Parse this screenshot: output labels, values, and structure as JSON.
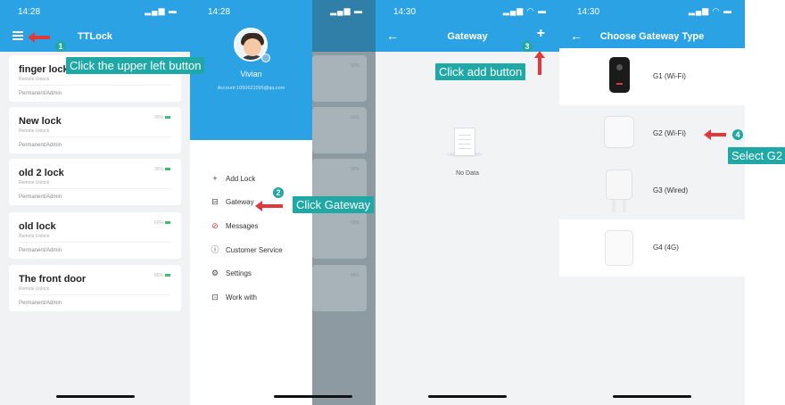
{
  "screens": {
    "locks": {
      "status_time": "14:28",
      "title": "TTLock",
      "locks": [
        {
          "name": "finger lock",
          "remote": "Remote Unlock",
          "permission": "Permanent/Admin",
          "battery": "",
          "battery_level": 0
        },
        {
          "name": "New lock",
          "remote": "Remote Unlock",
          "permission": "Permanent/Admin",
          "battery": "95%",
          "battery_level": 0.95
        },
        {
          "name": "old 2 lock",
          "remote": "Remote Unlock",
          "permission": "Permanent/Admin",
          "battery": "35%",
          "battery_level": 0.35
        },
        {
          "name": "old lock",
          "remote": "Remote Unlock",
          "permission": "Permanent/Admin",
          "battery": "60%",
          "battery_level": 0.6
        },
        {
          "name": "The front door",
          "remote": "Remote Unlock",
          "permission": "Permanent/Admin",
          "battery": "85%",
          "battery_level": 0.85
        }
      ]
    },
    "menu": {
      "status_time": "14:28",
      "user_name": "Vivian",
      "account": "Account:1050621595@qq.com",
      "items": [
        "Add Lock",
        "Gateway",
        "Messages",
        "Customer Service",
        "Settings",
        "Work with"
      ],
      "behind_battery": [
        "50%",
        "95%",
        "35%",
        "60%",
        "85%"
      ]
    },
    "gateway": {
      "status_time": "14:30",
      "title": "Gateway",
      "empty_text": "No Data"
    },
    "choose_type": {
      "status_time": "14:30",
      "title": "Choose Gateway Type",
      "types": [
        "G1 (Wi-Fi)",
        "G2 (Wi-Fi)",
        "G3 (Wired)",
        "G4 (4G)"
      ]
    }
  },
  "callouts": {
    "step1": "Click the upper left button",
    "step2": "Click Gateway",
    "step3": "Click add button",
    "step4": "Select G2"
  },
  "step_numbers": [
    "1",
    "2",
    "3",
    "4"
  ],
  "colors": {
    "brand_blue": "#2ba2e4",
    "callout_teal": "#20a8a6",
    "arrow_red": "#e0383b",
    "battery_green": "#3cc168"
  },
  "icons": [
    "menu-icon",
    "back-arrow-icon",
    "plus-icon",
    "add-icon",
    "gateway-icon",
    "messages-icon",
    "customer-service-icon",
    "settings-icon",
    "work-with-icon",
    "empty-document-icon"
  ]
}
